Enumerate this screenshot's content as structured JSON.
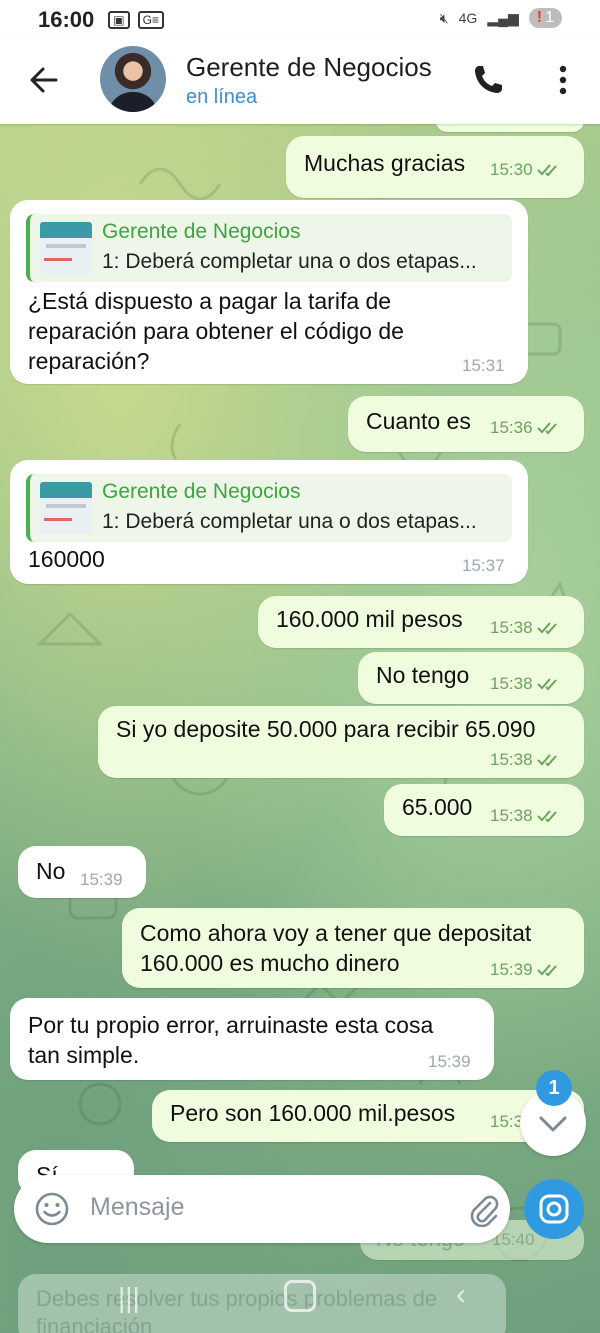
{
  "status_bar": {
    "time": "16:00",
    "sb_icon_2": "G≡",
    "network": "4G",
    "battery_badge": "1"
  },
  "header": {
    "title": "Gerente de Negocios",
    "subtitle": "en línea"
  },
  "messages": [
    {
      "dir": "out",
      "text": "Muchas gracias",
      "time": "15:30"
    },
    {
      "dir": "in",
      "reply_name": "Gerente de Negocios",
      "reply_text": "1: Deberá completar una o dos etapas...",
      "lines": [
        "¿Está dispuesto a pagar la tarifa de",
        "reparación para obtener el código de",
        "reparación?"
      ],
      "time": "15:31"
    },
    {
      "dir": "out",
      "text": "Cuanto es",
      "time": "15:36"
    },
    {
      "dir": "in",
      "reply_name": "Gerente de Negocios",
      "reply_text": "1: Deberá completar una o dos etapas...",
      "lines": [
        "160000"
      ],
      "time": "15:37"
    },
    {
      "dir": "out",
      "text": "160.000 mil pesos",
      "time": "15:38"
    },
    {
      "dir": "out",
      "text": "No tengo",
      "time": "15:38"
    },
    {
      "dir": "out",
      "text": "Si yo deposite 50.000 para recibir 65.090",
      "time": "15:38"
    },
    {
      "dir": "out",
      "text": "65.000",
      "time": "15:38"
    },
    {
      "dir": "in",
      "text": "No",
      "time": "15:39"
    },
    {
      "dir": "out",
      "lines": [
        "Como ahora voy a tener que depositat",
        "160.000 es mucho dinero"
      ],
      "time": "15:39"
    },
    {
      "dir": "in",
      "lines": [
        "Por tu propio error, arruinaste esta cosa",
        "tan simple."
      ],
      "time": "15:39"
    },
    {
      "dir": "out",
      "text": "Pero son 160.000 mil.pesos",
      "time": "15:3"
    },
    {
      "dir": "in",
      "text": "Sí",
      "time": ""
    }
  ],
  "ghost": {
    "no_tengo": "No tengo",
    "time": "15:40",
    "line1": "Debes resolver tus propios problemas de",
    "line2": "financiación"
  },
  "input": {
    "placeholder": "Mensaje"
  },
  "scroll": {
    "unread_count": "1"
  },
  "colors": {
    "accent": "#2f9ae0",
    "outgoing_bubble": "#effdde",
    "incoming_bubble": "#ffffff",
    "reply_name": "#3fa43f",
    "online": "#3a8fd0"
  }
}
